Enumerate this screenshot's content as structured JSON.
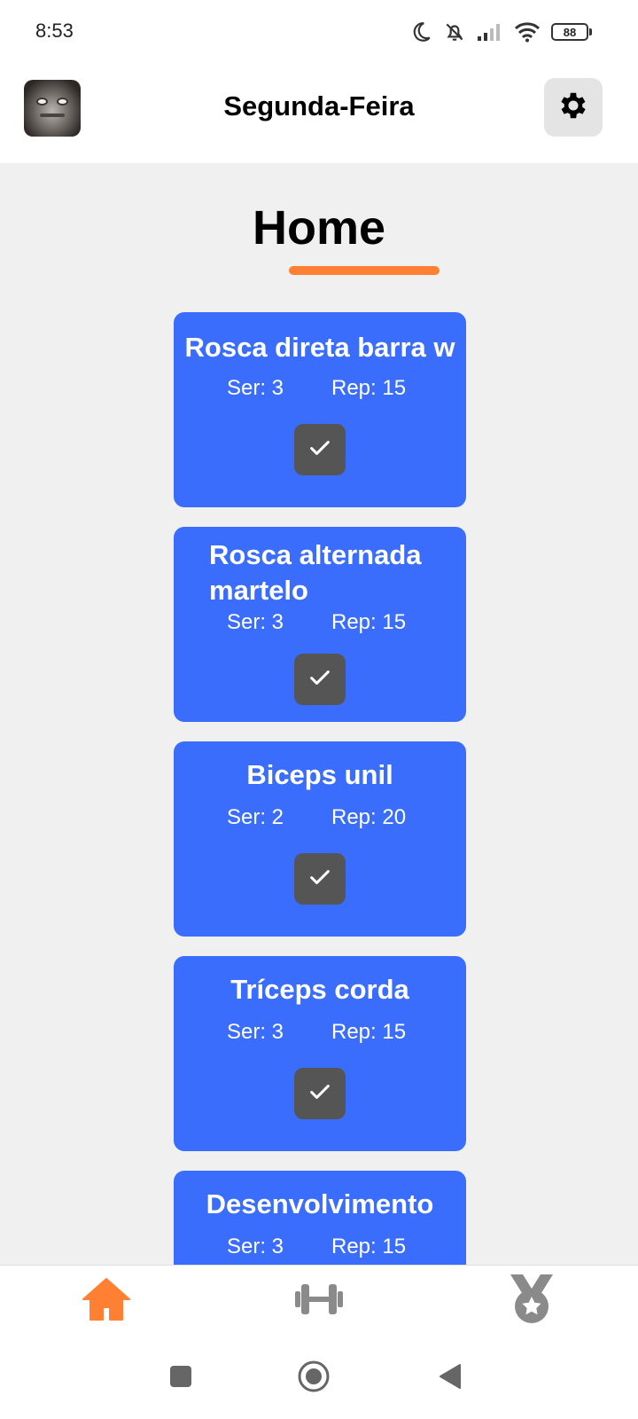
{
  "status_bar": {
    "time": "8:53",
    "battery": "88",
    "icons": [
      "moon-icon",
      "bell-off-icon",
      "signal-icon",
      "wifi-icon",
      "battery-icon"
    ]
  },
  "header": {
    "title": "Segunda-Feira",
    "avatar_icon": "frog-avatar",
    "settings_icon": "gear-icon"
  },
  "page": {
    "title": "Home",
    "accent_color": "#ff7f33"
  },
  "exercises": [
    {
      "name": "Rosca direta barra w",
      "series": "Ser: 3",
      "reps": "Rep: 15"
    },
    {
      "name": "Rosca alternada martelo",
      "series": "Ser: 3",
      "reps": "Rep: 15"
    },
    {
      "name": "Biceps unil",
      "series": "Ser: 2",
      "reps": "Rep: 20"
    },
    {
      "name": "Tríceps corda",
      "series": "Ser: 3",
      "reps": "Rep: 15"
    },
    {
      "name": "Desenvolvimento",
      "series": "Ser: 3",
      "reps": "Rep: 15"
    }
  ],
  "card_color": "#3a6dfb",
  "check_icon": "check-icon",
  "bottom_nav": {
    "items": [
      {
        "icon": "home-icon",
        "active": true,
        "color": "#ff7f33"
      },
      {
        "icon": "dumbbell-icon",
        "active": false,
        "color": "#8a8a8a"
      },
      {
        "icon": "medal-icon",
        "active": false,
        "color": "#8a8a8a"
      }
    ]
  },
  "system_nav": {
    "icons": [
      "recents-icon",
      "home-circle-icon",
      "back-icon"
    ]
  }
}
